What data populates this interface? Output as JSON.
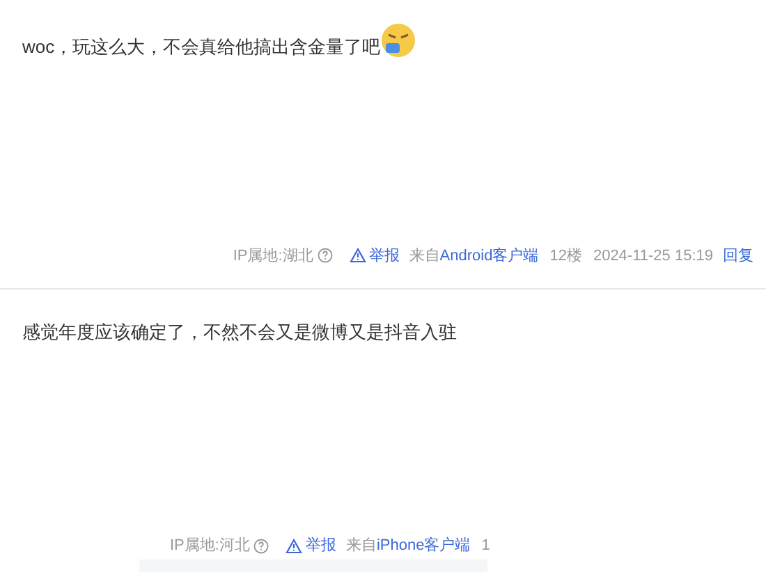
{
  "posts": [
    {
      "text": "woc，玩这么大，不会真给他搞出含金量了吧",
      "emoji": true,
      "footer": {
        "ip_location": "IP属地:湖北",
        "report": "举报",
        "source_prefix": "来自",
        "source": "Android客户端",
        "floor": "12楼",
        "time": "2024-11-25 15:19",
        "reply": "回复"
      }
    },
    {
      "text": "感觉年度应该确定了，不然不会又是微博又是抖音入驻",
      "emoji": false,
      "footer": {
        "ip_location": "IP属地:河北",
        "report": "举报",
        "source_prefix": "来自",
        "source": "iPhone客户端",
        "floor": "1"
      }
    }
  ]
}
